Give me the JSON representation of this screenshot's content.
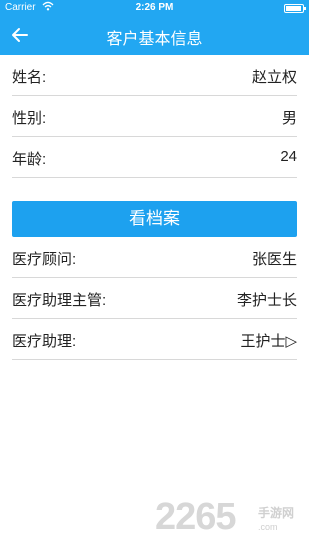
{
  "status_bar": {
    "carrier": "Carrier",
    "time": "2:26 PM"
  },
  "nav": {
    "title": "客户基本信息",
    "back_icon": "arrow-left-icon"
  },
  "basic_info": [
    {
      "label": "姓名:",
      "value": "赵立权"
    },
    {
      "label": "性别:",
      "value": "男"
    },
    {
      "label": "年龄:",
      "value": "24"
    }
  ],
  "archive_button": {
    "label": "看档案"
  },
  "medical_staff": [
    {
      "label": "医疗顾问:",
      "value": "张医生"
    },
    {
      "label": "医疗助理主管:",
      "value": "李护士长"
    },
    {
      "label": "医疗助理:",
      "value": "王护士▷"
    }
  ],
  "watermark": {
    "number": "2265",
    "tag": "手游网",
    "url": ".com"
  },
  "colors": {
    "header": "#22a7f2",
    "button": "#1da1ef",
    "divider": "#d8d8d8"
  }
}
